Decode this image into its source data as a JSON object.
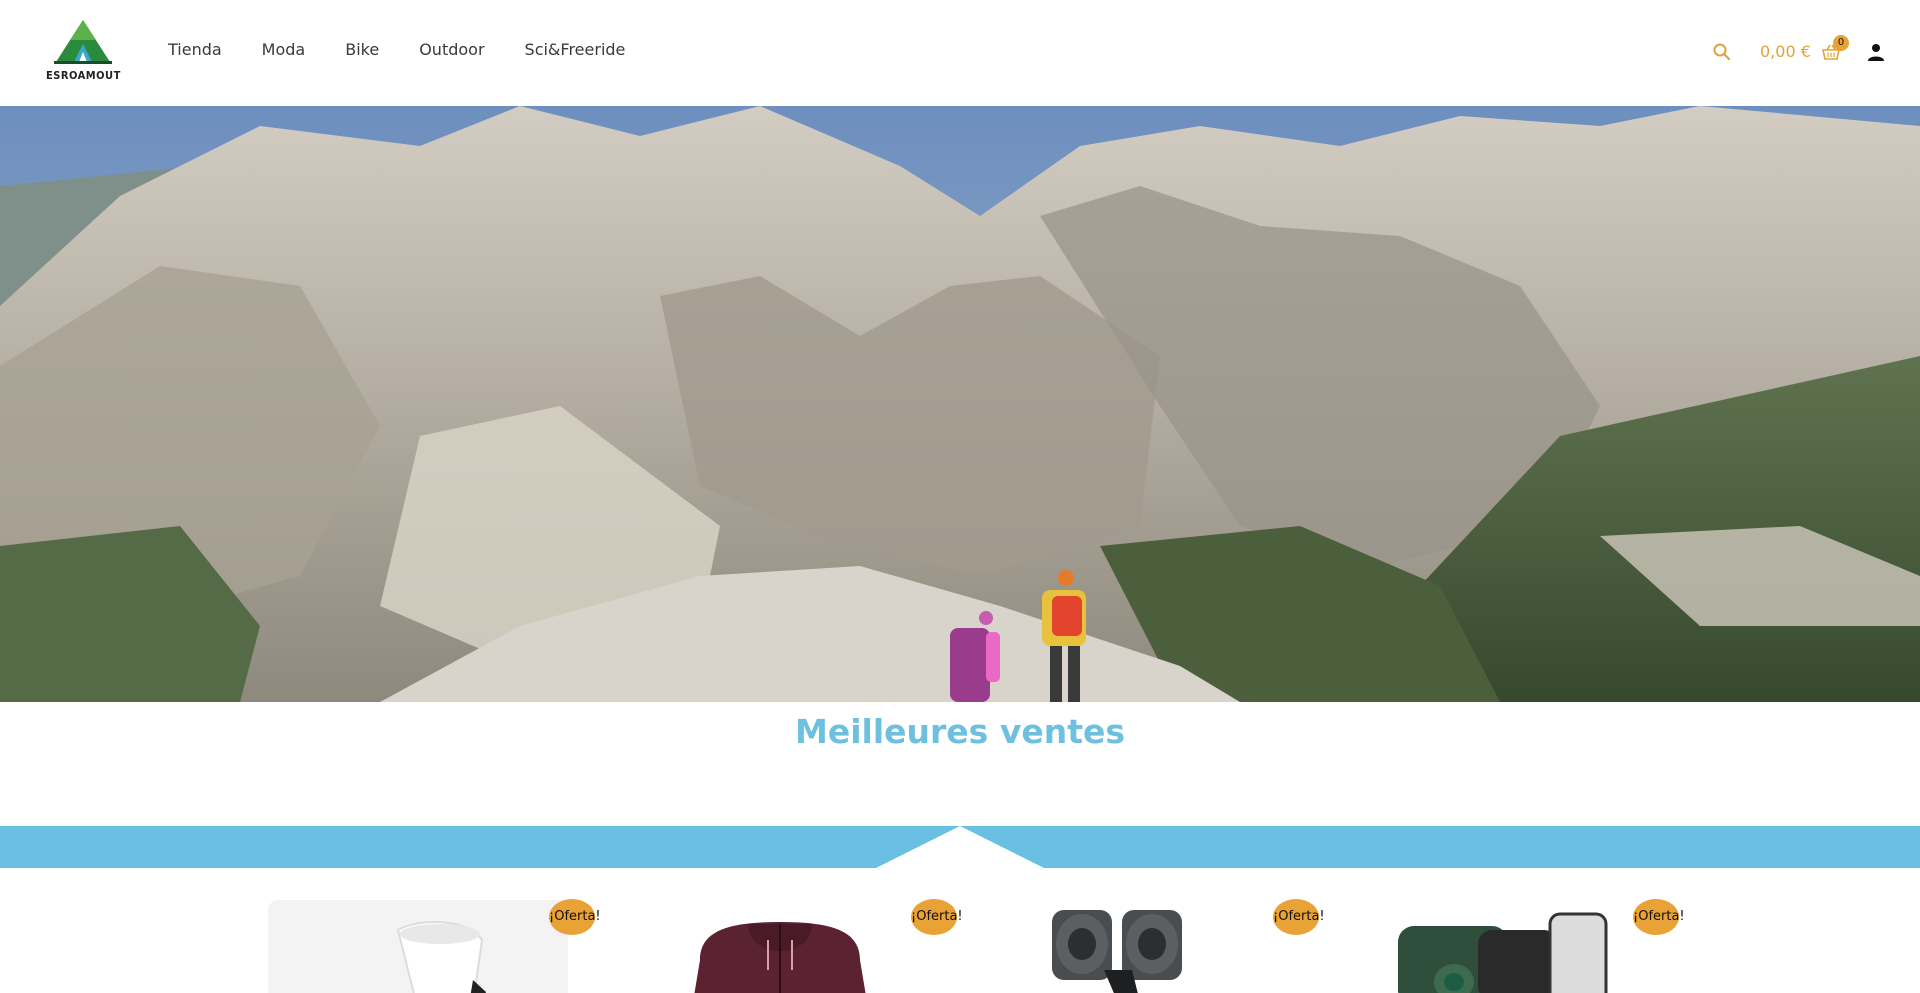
{
  "header": {
    "logo_text": "ESROAMOUT",
    "nav": [
      "Tienda",
      "Moda",
      "Bike",
      "Outdoor",
      "Sci&Freeride"
    ],
    "cart_total": "0,00 €",
    "cart_count": "0",
    "icons": {
      "search": "search-icon",
      "cart": "basket-icon",
      "user": "user-icon"
    }
  },
  "hero": {
    "image": "mountain-hikers-photo"
  },
  "best_sellers": {
    "title": "Meilleures ventes"
  },
  "products": [
    {
      "badge": "¡Oferta!",
      "image": "white-sock"
    },
    {
      "badge": "¡Oferta!",
      "image": "burgundy-hoodie"
    },
    {
      "badge": "¡Oferta!",
      "image": "gray-binoculars"
    },
    {
      "badge": "¡Oferta!",
      "image": "green-binoculars-with-phone"
    }
  ],
  "colors": {
    "accent": "#e9a236",
    "title_blue": "#6ec0e1",
    "band_blue": "#69c0e3",
    "nav_text": "#3a3a3a"
  }
}
